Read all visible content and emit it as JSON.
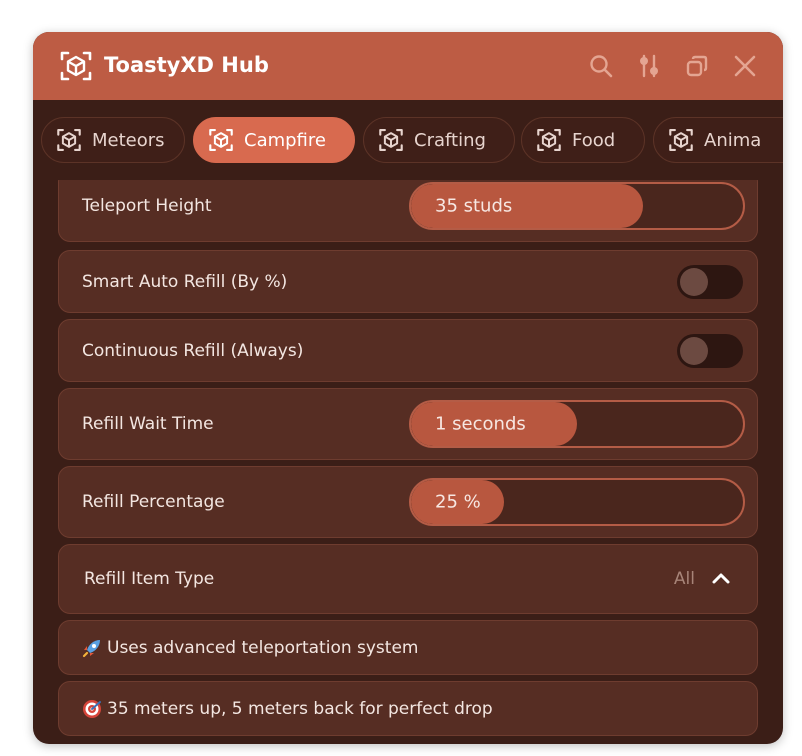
{
  "window": {
    "title": "ToastyXD Hub",
    "colors": {
      "titlebar": "#bd5c44",
      "accent": "#d86a4f",
      "background": "#3b1e17"
    },
    "title_icons": [
      "search-icon",
      "settings-sliders-icon",
      "window-copy-icon",
      "close-icon"
    ]
  },
  "tabs": [
    {
      "label": "Meteors",
      "icon": "cube-icon",
      "active": false
    },
    {
      "label": "Campfire",
      "icon": "cube-icon",
      "active": true
    },
    {
      "label": "Crafting",
      "icon": "cube-icon",
      "active": false
    },
    {
      "label": "Food",
      "icon": "cube-icon",
      "active": false
    },
    {
      "label": "Anima",
      "icon": "cube-icon",
      "active": false
    }
  ],
  "settings": {
    "teleport_height": {
      "label": "Teleport Height",
      "value_text": "35  studs",
      "fill": 0.7
    },
    "smart_auto_refill": {
      "label": "Smart Auto Refill (By %)",
      "enabled": false
    },
    "continuous_refill": {
      "label": "Continuous Refill (Always)",
      "enabled": false
    },
    "refill_wait_time": {
      "label": "Refill Wait Time",
      "value_text": "1  seconds",
      "fill": 0.5
    },
    "refill_percentage": {
      "label": "Refill Percentage",
      "value_text": "25 %",
      "fill": 0.28
    },
    "refill_item_type": {
      "label": "Refill Item Type",
      "value": "All",
      "expanded": true
    }
  },
  "info": [
    {
      "icon": "rocket-emoji",
      "text": "Uses advanced teleportation system"
    },
    {
      "icon": "target-emoji",
      "text": "35 meters up, 5 meters back for perfect drop"
    }
  ]
}
